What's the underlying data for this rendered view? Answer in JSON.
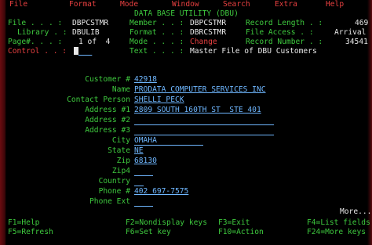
{
  "menu": [
    "File",
    "Format",
    "Mode",
    "Window",
    "Search",
    "Extra",
    "Help"
  ],
  "title": "DATA BASE UTILITY (DBU)",
  "header": {
    "file_label": "File . . . :",
    "file_value": "DBPCSTMR",
    "member_label": "Member . . :",
    "member_value": "DBPCSTMR",
    "reclen_label": "Record Length . :",
    "reclen_value": "469",
    "library_label": "Library . :",
    "library_value": "DBULIB",
    "format_label": "Format . . :",
    "format_value": "DBRCSTMR",
    "access_label": "File Access . :",
    "access_value": "Arrival",
    "page_label": "Page#. . . :",
    "page_value": "1 of  4",
    "mode_label": "Mode . . . :",
    "mode_value": "Change",
    "recnum_label": "Record Number . :",
    "recnum_value": "34541",
    "control_label": "Control . . :",
    "text_label": "Text . . . :",
    "text_value": "Master File of DBU Customers"
  },
  "fields": [
    {
      "label": "Customer #",
      "value": "42918"
    },
    {
      "label": "Name",
      "value": "PRODATA COMPUTER SERVICES INC"
    },
    {
      "label": "Contact Person",
      "value": "SHELLI PECK"
    },
    {
      "label": "Address #1",
      "value": "2809 SOUTH 160TH ST  STE 401"
    },
    {
      "label": "Address #2",
      "value": ""
    },
    {
      "label": "Address #3",
      "value": ""
    },
    {
      "label": "City",
      "value": "OMAHA"
    },
    {
      "label": "State",
      "value": "NE"
    },
    {
      "label": "Zip",
      "value": "68130"
    },
    {
      "label": "Zip4",
      "value": ""
    },
    {
      "label": "Country",
      "value": ""
    },
    {
      "label": "Phone #",
      "value": "402 697-7575"
    },
    {
      "label": "Phone Ext",
      "value": ""
    }
  ],
  "more": "More...",
  "fkeys": {
    "f1": "F1=Help",
    "f2": "F2=Nondisplay keys",
    "f3": "F3=Exit",
    "f4": "F4=List fields",
    "f5": "F5=Refresh",
    "f6": "F6=Set key",
    "f10": "F10=Action",
    "f24": "F24=More keys"
  }
}
